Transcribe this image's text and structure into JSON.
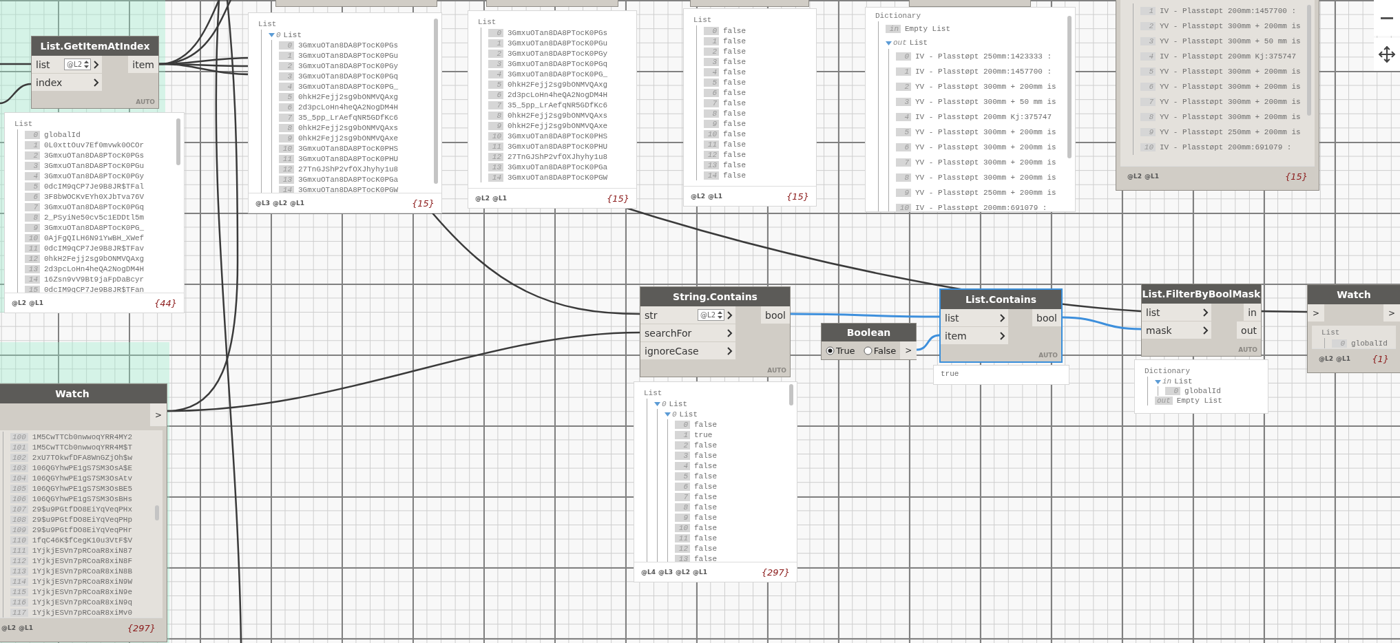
{
  "nodes": [
    {
      "kind": "stub",
      "preview": {
        "kind": "tree",
        "label": "List",
        "children": [
          {
            "index": "0",
            "label": "List",
            "expanded": true,
            "children": [
              {
                "index": "0",
                "value": "3GmxuOTan8DA8PTocK0PGs"
              },
              {
                "index": "1",
                "value": "3GmxuOTan8DA8PTocK0PGu"
              },
              {
                "index": "2",
                "value": "3GmxuOTan8DA8PTocK0PGy"
              },
              {
                "index": "3",
                "value": "3GmxuOTan8DA8PTocK0PGq"
              },
              {
                "index": "4",
                "value": "3GmxuOTan8DA8PTocK0PG_"
              },
              {
                "index": "5",
                "value": "0hkH2Fejj2sg9bONMVQAxg"
              },
              {
                "index": "6",
                "value": "2d3pcLoHn4heQA2NogDM4H"
              },
              {
                "index": "7",
                "value": "35_5pp_LrAefqNR5GDfKc6"
              },
              {
                "index": "8",
                "value": "0hkH2Fejj2sg9bONMVQAxs"
              },
              {
                "index": "9",
                "value": "0hkH2Fejj2sg9bONMVQAxe"
              },
              {
                "index": "10",
                "value": "3GmxuOTan8DA8PTocK0PHS"
              },
              {
                "index": "11",
                "value": "3GmxuOTan8DA8PTocK0PHU"
              },
              {
                "index": "12",
                "value": "27TnGJShP2vfOXJhyhy1u8"
              },
              {
                "index": "13",
                "value": "3GmxuOTan8DA8PTocK0PGa"
              },
              {
                "index": "14",
                "value": "3GmxuOTan8DA8PTocK0PGW"
              }
            ]
          }
        ],
        "levels": [
          "@L3",
          "@L2",
          "@L1"
        ],
        "count": "{15}"
      }
    },
    {
      "kind": "stub",
      "preview": {
        "kind": "tree",
        "label": "List",
        "children": [
          {
            "index": "0",
            "value": "3GmxuOTan8DA8PTocK0PGs"
          },
          {
            "index": "1",
            "value": "3GmxuOTan8DA8PTocK0PGu"
          },
          {
            "index": "2",
            "value": "3GmxuOTan8DA8PTocK0PGy"
          },
          {
            "index": "3",
            "value": "3GmxuOTan8DA8PTocK0PGq"
          },
          {
            "index": "4",
            "value": "3GmxuOTan8DA8PTocK0PG_"
          },
          {
            "index": "5",
            "value": "0hkH2Fejj2sg9bONMVQAxg"
          },
          {
            "index": "6",
            "value": "2d3pcLoHn4heQA2NogDM4H"
          },
          {
            "index": "7",
            "value": "35_5pp_LrAefqNR5GDfKc6"
          },
          {
            "index": "8",
            "value": "0hkH2Fejj2sg9bONMVQAxs"
          },
          {
            "index": "9",
            "value": "0hkH2Fejj2sg9bONMVQAxe"
          },
          {
            "index": "10",
            "value": "3GmxuOTan8DA8PTocK0PHS"
          },
          {
            "index": "11",
            "value": "3GmxuOTan8DA8PTocK0PHU"
          },
          {
            "index": "12",
            "value": "27TnGJShP2vfOXJhyhy1u8"
          },
          {
            "index": "13",
            "value": "3GmxuOTan8DA8PTocK0PGa"
          },
          {
            "index": "14",
            "value": "3GmxuOTan8DA8PTocK0PGW"
          }
        ],
        "levels": [
          "@L2",
          "@L1"
        ],
        "count": "{15}"
      }
    },
    {
      "kind": "stub",
      "preview": {
        "kind": "tree",
        "label": "List",
        "children": [
          {
            "index": "0",
            "value": "false"
          },
          {
            "index": "1",
            "value": "false"
          },
          {
            "index": "2",
            "value": "false"
          },
          {
            "index": "3",
            "value": "false"
          },
          {
            "index": "4",
            "value": "false"
          },
          {
            "index": "5",
            "value": "false"
          },
          {
            "index": "6",
            "value": "false"
          },
          {
            "index": "7",
            "value": "false"
          },
          {
            "index": "8",
            "value": "false"
          },
          {
            "index": "9",
            "value": "false"
          },
          {
            "index": "10",
            "value": "false"
          },
          {
            "index": "11",
            "value": "false"
          },
          {
            "index": "12",
            "value": "false"
          },
          {
            "index": "13",
            "value": "false"
          },
          {
            "index": "14",
            "value": "false"
          }
        ],
        "levels": [
          "@L2",
          "@L1"
        ],
        "count": "{15}"
      }
    },
    {
      "kind": "stub",
      "preview": {
        "kind": "tree",
        "label": "Dictionary",
        "children": [
          {
            "key": "in",
            "value": "Empty List"
          },
          {
            "key": "out",
            "label": "List",
            "expanded": true,
            "children": [
              {
                "index": "0",
                "value": "IV - Plasstøpt 250mm:1423333 :"
              },
              {
                "index": "1",
                "value": "IV - Plasstøpt 200mm:1457700 :"
              },
              {
                "index": "2",
                "value": "YV - Plasstøpt 300mm + 200mm is"
              },
              {
                "index": "3",
                "value": "YV - Plasstøpt 300mm + 50 mm is"
              },
              {
                "index": "4",
                "value": "IV - Plasstøpt 200mm Kj:375747"
              },
              {
                "index": "5",
                "value": "YV - Plasstøpt 300mm + 200mm is"
              },
              {
                "index": "6",
                "value": "YV - Plasstøpt 300mm + 200mm is"
              },
              {
                "index": "7",
                "value": "YV - Plasstøpt 300mm + 200mm is"
              },
              {
                "index": "8",
                "value": "YV - Plasstøpt 300mm + 200mm is"
              },
              {
                "index": "9",
                "value": "YV - Plasstøpt 250mm + 200mm is"
              },
              {
                "index": "10",
                "value": "IV - Plasstøpt 200mm:691079 :"
              }
            ]
          }
        ]
      }
    },
    {
      "kind": "watch",
      "preview": {
        "kind": "tree",
        "children": [
          {
            "index": "1",
            "value": "IV - Plasstøpt 200mm:1457700 :"
          },
          {
            "index": "2",
            "value": "YV - Plasstøpt 300mm + 200mm is"
          },
          {
            "index": "3",
            "value": "YV - Plasstøpt 300mm + 50 mm is"
          },
          {
            "index": "4",
            "value": "IV - Plasstøpt 200mm Kj:375747"
          },
          {
            "index": "5",
            "value": "YV - Plasstøpt 300mm + 200mm is"
          },
          {
            "index": "6",
            "value": "YV - Plasstøpt 300mm + 200mm is"
          },
          {
            "index": "7",
            "value": "YV - Plasstøpt 300mm + 200mm is"
          },
          {
            "index": "8",
            "value": "YV - Plasstøpt 300mm + 200mm is"
          },
          {
            "index": "9",
            "value": "YV - Plasstøpt 250mm + 200mm is"
          },
          {
            "index": "10",
            "value": "IV - Plasstøpt 200mm:691079 :"
          }
        ],
        "levels": [
          "@L2",
          "@L1"
        ],
        "count": "{15}"
      }
    },
    {
      "kind": "function",
      "title": "List.GetItemAtIndex",
      "selected": false,
      "inputs": [
        {
          "name": "list",
          "lacing": "@L2"
        },
        {
          "name": "index"
        }
      ],
      "outputs": [
        "item"
      ],
      "mode": "AUTO",
      "preview": {
        "kind": "tree",
        "label": "List",
        "children": [
          {
            "index": "0",
            "value": "globalId"
          },
          {
            "index": "1",
            "value": "0L0xttOuv7Ef0mvwk0OCOr"
          },
          {
            "index": "2",
            "value": "3GmxuOTan8DA8PTocK0PGs"
          },
          {
            "index": "3",
            "value": "3GmxuOTan8DA8PTocK0PGu"
          },
          {
            "index": "4",
            "value": "3GmxuOTan8DA8PTocK0PGy"
          },
          {
            "index": "5",
            "value": "0dcIM9qCP7Je9B8JR$TFal"
          },
          {
            "index": "6",
            "value": "3F8bWOCKvEYh0XJbTva76V"
          },
          {
            "index": "7",
            "value": "3GmxuOTan8DA8PTocK0PGq"
          },
          {
            "index": "8",
            "value": "2_PSyiNe50cv5c1EDDtl5m"
          },
          {
            "index": "9",
            "value": "3GmxuOTan8DA8PTocK0PG_"
          },
          {
            "index": "10",
            "value": "0AjFgQILH6N91YwBH_XWef"
          },
          {
            "index": "11",
            "value": "0dcIM9qCP7Je9B8JR$TFav"
          },
          {
            "index": "12",
            "value": "0hkH2Fejj2sg9bONMVQAxg"
          },
          {
            "index": "13",
            "value": "2d3pcLoHn4heQA2NogDM4H"
          },
          {
            "index": "14",
            "value": "16Zsn9vV9Bt9jaFpDaBcyr"
          },
          {
            "index": "15",
            "value": "0dcIM9qCP7Je9B8JR$TFan"
          }
        ],
        "levels": [
          "@L2",
          "@L1"
        ],
        "count": "{44}"
      }
    },
    {
      "kind": "function",
      "title": "String.Contains",
      "selected": false,
      "inputs": [
        {
          "name": "str",
          "lacing": "@L2"
        },
        {
          "name": "searchFor"
        },
        {
          "name": "ignoreCase"
        }
      ],
      "outputs": [
        "bool"
      ],
      "mode": "AUTO",
      "preview": {
        "kind": "tree",
        "label": "List",
        "children": [
          {
            "index": "0",
            "label": "List",
            "expanded": true,
            "children": [
              {
                "index": "0",
                "label": "List",
                "expanded": true,
                "children": [
                  {
                    "index": "0",
                    "value": "false"
                  },
                  {
                    "index": "1",
                    "value": "true"
                  },
                  {
                    "index": "2",
                    "value": "false"
                  },
                  {
                    "index": "3",
                    "value": "false"
                  },
                  {
                    "index": "4",
                    "value": "false"
                  },
                  {
                    "index": "5",
                    "value": "false"
                  },
                  {
                    "index": "6",
                    "value": "false"
                  },
                  {
                    "index": "7",
                    "value": "false"
                  },
                  {
                    "index": "8",
                    "value": "false"
                  },
                  {
                    "index": "9",
                    "value": "false"
                  },
                  {
                    "index": "10",
                    "value": "false"
                  },
                  {
                    "index": "11",
                    "value": "false"
                  },
                  {
                    "index": "12",
                    "value": "false"
                  },
                  {
                    "index": "13",
                    "value": "false"
                  }
                ]
              }
            ]
          }
        ],
        "levels": [
          "@L4",
          "@L3",
          "@L2",
          "@L1"
        ],
        "count": "{297}"
      }
    },
    {
      "kind": "boolean",
      "title": "Boolean",
      "options": [
        {
          "label": "True",
          "selected": true
        },
        {
          "label": "False",
          "selected": false
        }
      ],
      "output": ">"
    },
    {
      "kind": "function",
      "title": "List.Contains",
      "selected": true,
      "inputs": [
        {
          "name": "list"
        },
        {
          "name": "item"
        }
      ],
      "outputs": [
        "bool"
      ],
      "mode": "AUTO",
      "preview": {
        "kind": "value",
        "value": "true"
      }
    },
    {
      "kind": "function",
      "title": "List.FilterByBoolMask",
      "selected": false,
      "inputs": [
        {
          "name": "list"
        },
        {
          "name": "mask"
        }
      ],
      "outputs": [
        "in",
        "out"
      ],
      "mode": "AUTO",
      "preview": {
        "kind": "tree",
        "label": "Dictionary",
        "children": [
          {
            "key": "in",
            "label": "List",
            "expanded": true,
            "children": [
              {
                "index": "0",
                "value": "globalId"
              }
            ]
          },
          {
            "key": "out",
            "value": "Empty List"
          }
        ]
      }
    },
    {
      "kind": "watch",
      "title": "Watch",
      "input": ">",
      "output": ">",
      "preview": {
        "kind": "tree",
        "label": "List",
        "children": [
          {
            "index": "0",
            "value": "globalId"
          }
        ],
        "levels": [
          "@L2",
          "@L1"
        ],
        "count": "{1}"
      }
    },
    {
      "kind": "watch",
      "title": "Watch",
      "output": ">",
      "preview": {
        "kind": "tree",
        "children": [
          {
            "index": "100",
            "value": "1M5CwTTCb0nwwoqYRR4MY2"
          },
          {
            "index": "101",
            "value": "1M5CwTTCb0nwwoqYRR4M$T"
          },
          {
            "index": "102",
            "value": "2xU7TOkwfDFA8WnGZjOh$w"
          },
          {
            "index": "103",
            "value": "106QGYhwPE1gS7SM3OsA$E"
          },
          {
            "index": "104",
            "value": "106QGYhwPE1gS7SM3OsAtv"
          },
          {
            "index": "105",
            "value": "106QGYhwPE1gS7SM3OsBE5"
          },
          {
            "index": "106",
            "value": "106QGYhwPE1gS7SM3OsBHs"
          },
          {
            "index": "107",
            "value": "29$u9PGtfDO8EiYqVeqPHx"
          },
          {
            "index": "108",
            "value": "29$u9PGtfDO8EiYqVeqPHp"
          },
          {
            "index": "109",
            "value": "29$u9PGtfDO8EiYqVeqPHr"
          },
          {
            "index": "110",
            "value": "1fqC46K$fCegK10u3VtF$V"
          },
          {
            "index": "111",
            "value": "1YjkjESVn7pRCoaR8xiN87"
          },
          {
            "index": "112",
            "value": "1YjkjESVn7pRCoaR8xiN8F"
          },
          {
            "index": "113",
            "value": "1YjkjESVn7pRCoaR8xiN8B"
          },
          {
            "index": "114",
            "value": "1YjkjESVn7pRCoaR8xiN9W"
          },
          {
            "index": "115",
            "value": "1YjkjESVn7pRCoaR8xiN9e"
          },
          {
            "index": "116",
            "value": "1YjkjESVn7pRCoaR8xiN9q"
          },
          {
            "index": "117",
            "value": "1YjkjESVn7pRCoaR8xiMv0"
          }
        ],
        "levels": [
          "@L2",
          "@L1"
        ],
        "count": "{297}"
      }
    }
  ]
}
